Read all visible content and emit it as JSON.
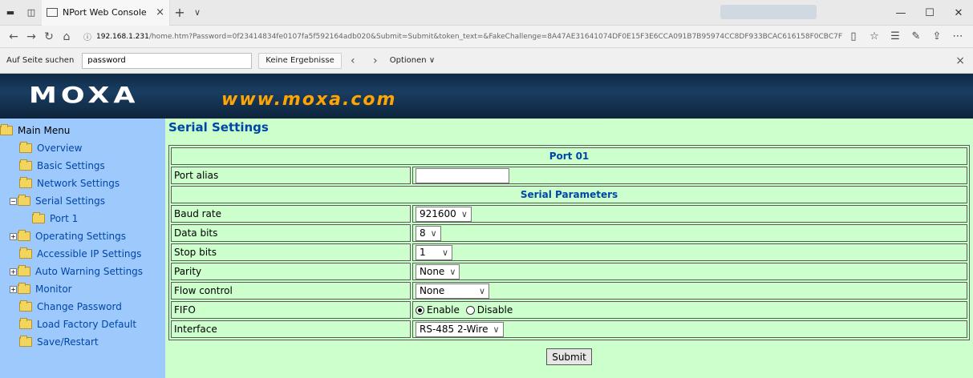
{
  "browser": {
    "tab_title": "NPort Web Console",
    "new_tab_symbol": "+",
    "tab_menu_symbol": "∨",
    "url_host": "192.168.1.231",
    "url_rest": "/home.htm?Password=0f23414834fe0107fa5f592164adb020&Submit=Submit&token_text=&FakeChallenge=8A47AE31641074DF0E15F3E6CCA091B7B95974CC8DF933BCAC616158F0CBC7F7"
  },
  "findbar": {
    "label": "Auf Seite suchen",
    "query": "password",
    "result": "Keine Ergebnisse",
    "options_label": "Optionen"
  },
  "banner": {
    "logo": "MOXA",
    "site": "www.moxa.com"
  },
  "menu": {
    "root": "Main Menu",
    "items": [
      {
        "label": "Overview"
      },
      {
        "label": "Basic Settings"
      },
      {
        "label": "Network Settings"
      },
      {
        "label": "Serial Settings"
      },
      {
        "label": "Port 1"
      },
      {
        "label": "Operating Settings"
      },
      {
        "label": "Accessible IP Settings"
      },
      {
        "label": "Auto Warning Settings"
      },
      {
        "label": "Monitor"
      },
      {
        "label": "Change Password"
      },
      {
        "label": "Load Factory Default"
      },
      {
        "label": "Save/Restart"
      }
    ]
  },
  "page": {
    "title": "Serial Settings",
    "port_header": "Port 01",
    "port_alias_label": "Port alias",
    "port_alias_value": "",
    "params_header": "Serial Parameters",
    "baud_label": "Baud rate",
    "baud_value": "921600",
    "databits_label": "Data bits",
    "databits_value": "8",
    "stopbits_label": "Stop bits",
    "stopbits_value": "1",
    "parity_label": "Parity",
    "parity_value": "None",
    "flow_label": "Flow control",
    "flow_value": "None",
    "fifo_label": "FIFO",
    "fifo_enable": "Enable",
    "fifo_disable": "Disable",
    "interface_label": "Interface",
    "interface_value": "RS-485 2-Wire",
    "submit_label": "Submit"
  }
}
